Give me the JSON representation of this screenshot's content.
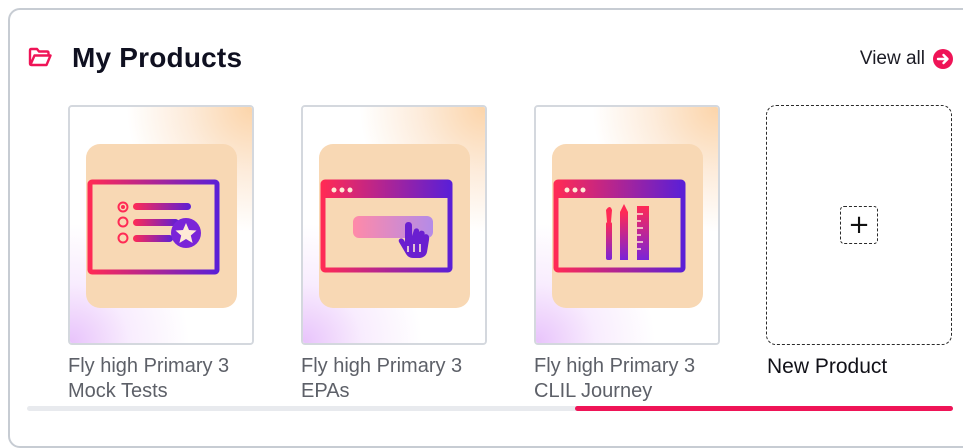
{
  "header": {
    "title": "My Products",
    "view_all_label": "View all",
    "icon": "folder-open-icon",
    "view_all_icon": "arrow-right-circle-icon",
    "accent_color": "#ef1457"
  },
  "products": [
    {
      "caption": "Fly high Primary 3 Mock Tests",
      "icon": "mock-tests-list-star-icon"
    },
    {
      "caption": "Fly high Primary 3 EPAs",
      "icon": "browser-click-hand-icon"
    },
    {
      "caption": "Fly high Primary 3 CLIL Journey",
      "icon": "browser-art-tools-icon"
    }
  ],
  "new_product": {
    "label": "New Product",
    "plus_glyph": "+",
    "icon": "plus-icon"
  },
  "scrollbar": {
    "thumb_color": "#ef1457",
    "track_color": "#e8eaee"
  }
}
